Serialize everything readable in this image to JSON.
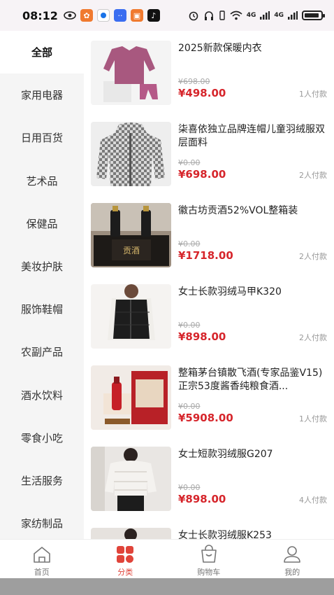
{
  "status_bar": {
    "time": "08:12",
    "network_labels": [
      "4G",
      "4G"
    ]
  },
  "sidebar": {
    "items": [
      {
        "label": "全部",
        "active": true
      },
      {
        "label": "家用电器"
      },
      {
        "label": "日用百货"
      },
      {
        "label": "艺术品"
      },
      {
        "label": "保健品"
      },
      {
        "label": "美妆护肤"
      },
      {
        "label": "服饰鞋帽"
      },
      {
        "label": "农副产品"
      },
      {
        "label": "酒水饮料"
      },
      {
        "label": "零食小吃"
      },
      {
        "label": "生活服务"
      },
      {
        "label": "家纺制品"
      }
    ]
  },
  "products": [
    {
      "title": "2025新款保暖内衣",
      "original_price": "¥698.00",
      "price": "¥498.00",
      "sales": "1人付款",
      "image": "sweater-photo"
    },
    {
      "title": "柒喜依独立品牌连帽儿童羽绒服双层面料",
      "original_price": "¥0.00",
      "price": "¥698.00",
      "sales": "2人付款",
      "image": "kids-jacket-photo"
    },
    {
      "title": "徽古坊贡酒52%VOL整箱装",
      "original_price": "¥0.00",
      "price": "¥1718.00",
      "sales": "2人付款",
      "image": "liquor-box-photo"
    },
    {
      "title": "女士长款羽绒马甲K320",
      "original_price": "¥0.00",
      "price": "¥898.00",
      "sales": "2人付款",
      "image": "vest-photo"
    },
    {
      "title": "整箱茅台镇散飞酒(专家品鉴V15)正宗53度酱香纯粮食酒...",
      "original_price": "¥0.00",
      "price": "¥5908.00",
      "sales": "1人付款",
      "image": "red-liquor-photo"
    },
    {
      "title": "女士短款羽绒服G207",
      "original_price": "¥0.00",
      "price": "¥898.00",
      "sales": "4人付款",
      "image": "white-jacket-photo"
    },
    {
      "title": "女士长款羽绒服K253",
      "original_price": "",
      "price": "",
      "sales": "",
      "image": "partial-photo"
    }
  ],
  "tabbar": {
    "items": [
      {
        "label": "首页",
        "icon": "home-icon"
      },
      {
        "label": "分类",
        "icon": "category-icon",
        "active": true
      },
      {
        "label": "购物车",
        "icon": "cart-icon"
      },
      {
        "label": "我的",
        "icon": "user-icon"
      }
    ]
  },
  "colors": {
    "accent": "#d6252b",
    "tab_active": "#e0443a",
    "sidebar_bg": "#f5f5f5"
  }
}
